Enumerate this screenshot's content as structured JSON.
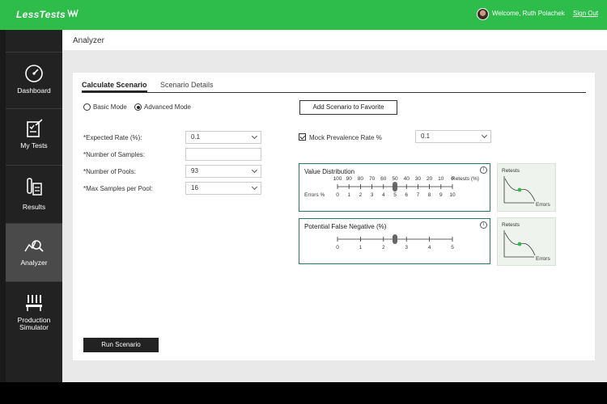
{
  "header": {
    "logo": "LessTests",
    "welcome": "Welcome, Ruth Polachek",
    "sign_out": "Sign Out",
    "accent_color": "#2ebd4b"
  },
  "sidebar": {
    "items": [
      {
        "label": "Dashboard",
        "icon": "gauge-icon"
      },
      {
        "label": "My Tests",
        "icon": "clipboard-check-icon"
      },
      {
        "label": "Results",
        "icon": "test-tube-icon"
      },
      {
        "label": "Analyzer",
        "icon": "chart-magnifier-icon",
        "active": true
      },
      {
        "label": "Production Simulator",
        "icon": "tube-rack-icon"
      }
    ]
  },
  "page": {
    "title": "Analyzer"
  },
  "tabs": [
    {
      "label": "Calculate Scenario",
      "active": true
    },
    {
      "label": "Scenario Details",
      "active": false
    }
  ],
  "mode": {
    "basic": "Basic Mode",
    "advanced": "Advanced Mode",
    "selected": "Advanced Mode"
  },
  "favorite_button": "Add Scenario to Favorite",
  "fields": {
    "expected_rate": {
      "label": "*Expected Rate (%):",
      "value": "0.1"
    },
    "num_samples": {
      "label": "*Number of Samples:",
      "value": ""
    },
    "num_pools": {
      "label": "*Number of Pools:",
      "value": "93"
    },
    "max_samples": {
      "label": "*Max Samples per Pool:",
      "value": "16"
    }
  },
  "mock_prevalence": {
    "label": "Mock Prevalence Rate %",
    "checked": true,
    "value": "0.1"
  },
  "value_distribution": {
    "title": "Value Distribution",
    "retests_ticks": [
      "100",
      "90",
      "80",
      "70",
      "60",
      "50",
      "40",
      "30",
      "20",
      "10",
      "0"
    ],
    "retests_label": "Retests (%)",
    "errors_label": "Errors %",
    "errors_ticks": [
      "0",
      "1",
      "2",
      "3",
      "4",
      "5",
      "6",
      "7",
      "8",
      "9",
      "10"
    ],
    "slider_value": 5
  },
  "false_negative": {
    "title": "Potential False Negative (%)",
    "ticks": [
      "0",
      "1",
      "2",
      "3",
      "4",
      "5"
    ],
    "slider_value": 2.5
  },
  "mini_charts": {
    "top": {
      "y_label": "Retests",
      "x_label": "Errors"
    },
    "bottom": {
      "y_label": "Retests",
      "x_label": "Errors"
    }
  },
  "run_button": "Run Scenario"
}
